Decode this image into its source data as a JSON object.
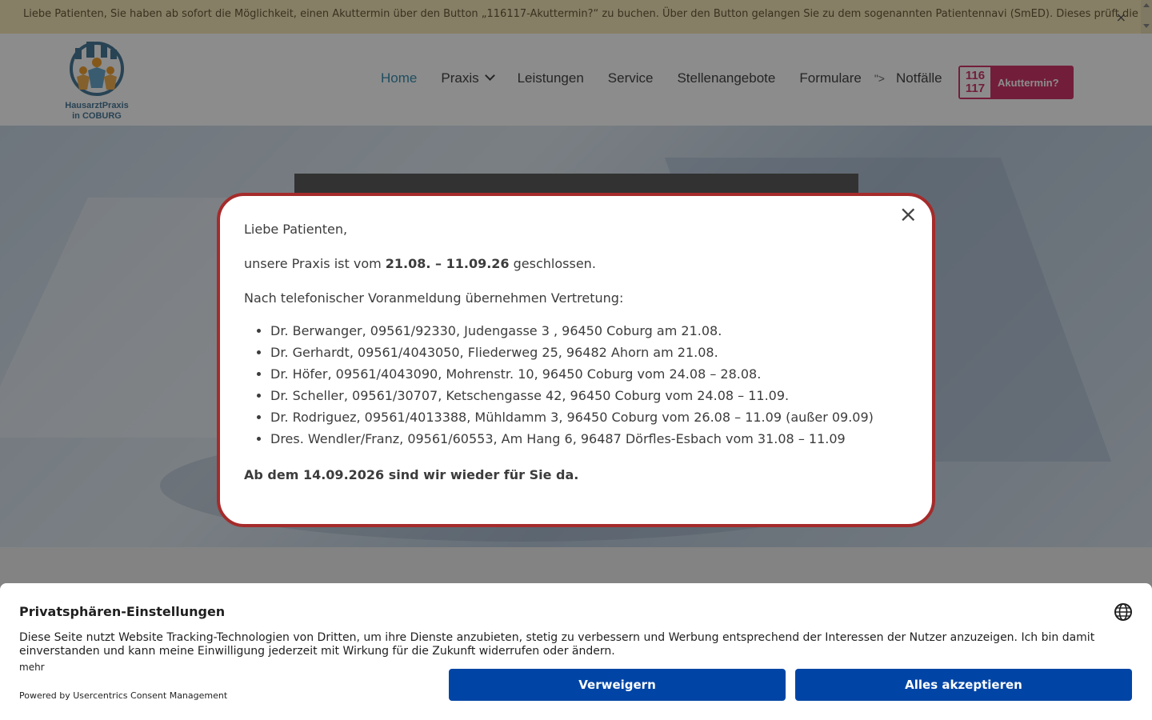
{
  "announcement": {
    "text": "Liebe Patienten, Sie haben ab sofort die Möglichkeit, einen Akuttermin über den Button „116117-Akuttermin?“ zu buchen. Über den Button gelangen Sie zu dem sogenannten Patientennavi (SmED). Dieses prüft die Dringlichkeit Ihrer",
    "close": "×"
  },
  "logo": {
    "line1": "HausarztPraxis",
    "line2": "in COBURG"
  },
  "nav": {
    "items": [
      "Home",
      "Praxis",
      "Leistungen",
      "Service",
      "Stellenangebote",
      "Formulare",
      "Notfälle"
    ],
    "separator": "\">",
    "cta_badge_top": "116",
    "cta_badge_bottom": "117",
    "cta_label": "Akuttermin?"
  },
  "modal": {
    "close": "×",
    "greeting": "Liebe Patienten,",
    "closed_prefix": "unsere Praxis ist vom ",
    "closed_dates": "21.08. – 11.09.26",
    "closed_suffix": " geschlossen.",
    "substitute_intro": "Nach telefonischer Voranmeldung übernehmen Vertretung:",
    "substitutes": [
      "Dr. Berwanger, 09561/92330, Judengasse 3 , 96450 Coburg am 21.08.",
      "Dr. Gerhardt, 09561/4043050, Fliederweg 25, 96482 Ahorn am 21.08.",
      "Dr. Höfer, 09561/4043090, Mohrenstr. 10, 96450 Coburg vom 24.08 – 28.08.",
      "Dr. Scheller, 09561/30707, Ketschengasse 42, 96450 Coburg vom 24.08 – 11.09.",
      "Dr. Rodriguez, 09561/4013388, Mühldamm 3, 96450 Coburg vom 26.08 – 11.09 (außer 09.09)",
      "Dres. Wendler/Franz, 09561/60553, Am Hang 6, 96487 Dörfles-Esbach vom 31.08 – 11.09"
    ],
    "reopen": "Ab dem 14.09.2026 sind wir wieder für Sie da."
  },
  "consent": {
    "title": "Privatsphären-Einstellungen",
    "text": "Diese Seite nutzt Website Tracking-Technologien von Dritten, um ihre Dienste anzubieten, stetig zu verbessern und Werbung entsprechend der Interessen der Nutzer anzuzeigen. Ich bin damit einverstanden und kann meine Einwilligung jederzeit mit Wirkung für die Zukunft widerrufen oder ändern.",
    "more": "mehr",
    "powered": "Powered by Usercentrics Consent Management",
    "deny": "Verweigern",
    "accept": "Alles akzeptieren"
  },
  "colors": {
    "brand_blue": "#3a8eaf",
    "modal_border": "#a52b2b",
    "cta_pink": "#d0386b",
    "consent_button": "#0045a5"
  }
}
